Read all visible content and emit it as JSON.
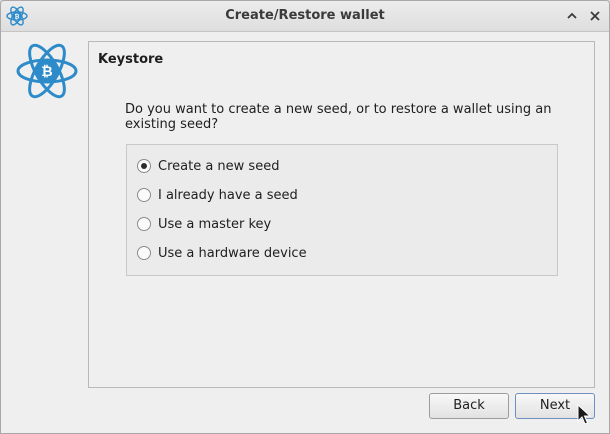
{
  "window": {
    "title": "Create/Restore wallet"
  },
  "icons": {
    "app": "electrum-logo-icon",
    "maximize": "chevron-up-icon",
    "close": "close-icon",
    "logo": "electrum-logo-icon"
  },
  "colors": {
    "logo_blue": "#2D8BC9",
    "logo_dark": "#1E6FA8"
  },
  "panel": {
    "title": "Keystore",
    "question": "Do you want to create a new seed, or to restore a wallet using an existing seed?",
    "options": [
      {
        "label": "Create a new seed",
        "selected": true
      },
      {
        "label": "I already have a seed",
        "selected": false
      },
      {
        "label": "Use a master key",
        "selected": false
      },
      {
        "label": "Use a hardware device",
        "selected": false
      }
    ]
  },
  "buttons": {
    "back": "Back",
    "next": "Next"
  }
}
